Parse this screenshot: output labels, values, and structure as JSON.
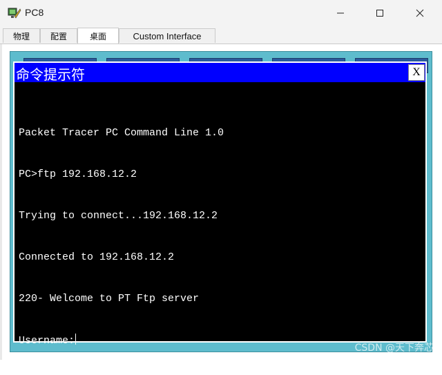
{
  "window": {
    "title": "PC8",
    "minimize_glyph": "—",
    "maximize_glyph": "☐",
    "close_glyph": "✕"
  },
  "tabs": [
    {
      "label": "物理"
    },
    {
      "label": "配置"
    },
    {
      "label": "桌面",
      "active": true
    },
    {
      "label": "Custom Interface"
    }
  ],
  "cmd_window": {
    "title": "命令提示符",
    "close_label": "X",
    "lines": [
      "Packet Tracer PC Command Line 1.0",
      "PC>ftp 192.168.12.2",
      "Trying to connect...192.168.12.2",
      "Connected to 192.168.12.2",
      "220- Welcome to PT Ftp server"
    ],
    "prompt_line": "Username:"
  },
  "watermark": "CSDN @天下奔芯",
  "colors": {
    "cmd_title_bg": "#0000ff",
    "terminal_bg": "#000000",
    "terminal_fg": "#ffffff",
    "desktop_bg": "#5ebccd"
  },
  "icons": {
    "app_icon": "packet-tracer-pc-icon"
  }
}
